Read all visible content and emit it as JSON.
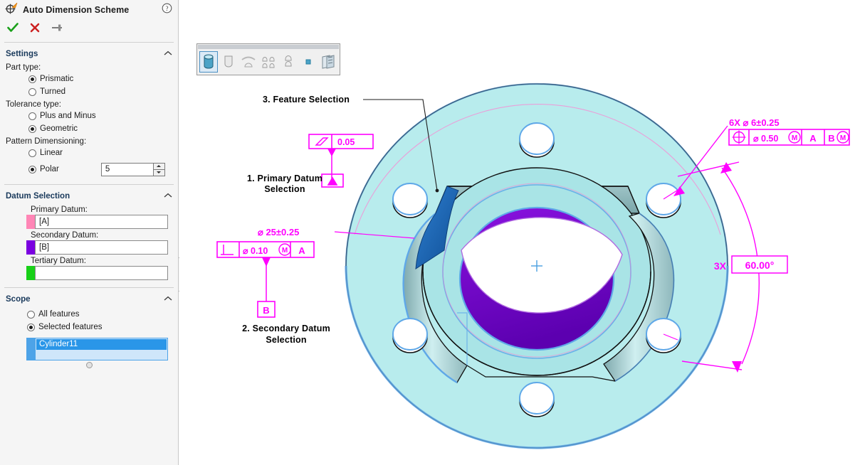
{
  "panel": {
    "title": "Auto Dimension Scheme",
    "icon": "auto-dimension-scheme-icon",
    "help_icon": "help-icon",
    "actions": {
      "accept_icon": "check-icon",
      "cancel_icon": "x-icon",
      "pin_icon": "pin-icon"
    },
    "settings": {
      "title": "Settings",
      "collapse_icon": "chevron-up-icon",
      "part_type_label": "Part type:",
      "part_type_options": [
        {
          "label": "Prismatic",
          "selected": true
        },
        {
          "label": "Turned",
          "selected": false
        }
      ],
      "tolerance_type_label": "Tolerance type:",
      "tolerance_type_options": [
        {
          "label": "Plus and Minus",
          "selected": false
        },
        {
          "label": "Geometric",
          "selected": true
        }
      ],
      "pattern_label": "Pattern Dimensioning:",
      "pattern_options": [
        {
          "label": "Linear",
          "selected": false
        },
        {
          "label": "Polar",
          "selected": true
        }
      ],
      "pattern_count": "5"
    },
    "datum_selection": {
      "title": "Datum Selection",
      "collapse_icon": "chevron-up-icon",
      "primary_label": "Primary Datum:",
      "primary_value": "[A]",
      "primary_color": "#ff86b6",
      "secondary_label": "Secondary Datum:",
      "secondary_value": "[B]",
      "secondary_color": "#7a00e0",
      "tertiary_label": "Tertiary Datum:",
      "tertiary_value": "",
      "tertiary_color": "#18d018"
    },
    "scope": {
      "title": "Scope",
      "collapse_icon": "chevron-up-icon",
      "options": [
        {
          "label": "All features",
          "selected": false
        },
        {
          "label": "Selected features",
          "selected": true
        }
      ],
      "selected_items": [
        "Cylinder11"
      ],
      "swatch_color": "#4da3e8"
    }
  },
  "toolbar": {
    "buttons": [
      {
        "name": "cylinder-feature-icon",
        "active": true
      },
      {
        "name": "pocket-feature-icon",
        "active": false
      },
      {
        "name": "fillet-feature-icon",
        "active": false
      },
      {
        "name": "hole-pattern-feature-icon",
        "active": false
      },
      {
        "name": "hole-feature-icon",
        "active": false
      },
      {
        "name": "plane-feature-icon",
        "active": false
      },
      {
        "name": "multi-face-feature-icon",
        "active": false
      }
    ]
  },
  "annotations": {
    "callout_primary": "1. Primary Datum\nSelection",
    "callout_primary_line1": "1. Primary Datum",
    "callout_primary_line2": "Selection",
    "callout_secondary_line1": "2. Secondary Datum",
    "callout_secondary_line2": "Selection",
    "callout_feature": "3. Feature Selection",
    "flatness_value": "0.05",
    "flatness_symbol": "flatness-icon",
    "datum_a_label": "A",
    "datum_b_label": "B",
    "bore_dimension": "⌀ 25±0.25",
    "perpendicularity_symbol": "perpendicularity-icon",
    "perpendicularity_tol": "⌀ 0.10",
    "perpendicularity_modifier": "M",
    "perpendicularity_datum": "A",
    "hole_count_dimension": "6X  ⌀  6±0.25",
    "position_symbol": "position-icon",
    "position_tol": "⌀ 0.50",
    "position_modifier": "M",
    "position_datum_primary": "A",
    "position_datum_secondary": "B",
    "position_datum_secondary_modifier": "M",
    "angle_count": "3X",
    "angle_value": "60.00°",
    "annotation_color": "#ff00ff"
  },
  "model": {
    "face_color": "#b8eced",
    "highlight_primary_color": "#1f6ab4",
    "highlight_secondary_color": "#6a00d4",
    "edge_highlight_color": "#5fa8e8",
    "shade_color": "#8fb8ba"
  }
}
